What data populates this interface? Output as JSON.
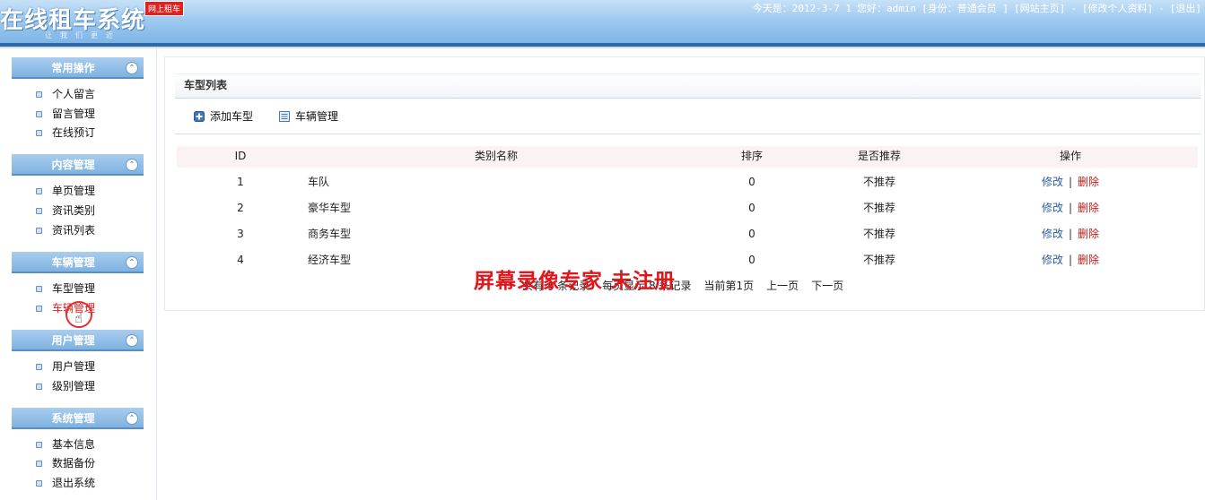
{
  "header": {
    "logo_title": "在线租车系统",
    "logo_badge": "网上租车",
    "logo_slogan": "让我们更近",
    "date_text": "今天是：2012-3-7 1",
    "greeting": "您好：admin",
    "identity": "[身份：普通会员 ]",
    "site_home": "[网站主页]",
    "dash1": "-",
    "edit_profile": "[修改个人资料]",
    "dash2": "-",
    "logout": "[退出]"
  },
  "sidebar": {
    "groups": [
      {
        "title": "常用操作",
        "items": [
          "个人留言",
          "留言管理",
          "在线预订"
        ]
      },
      {
        "title": "内容管理",
        "items": [
          "单页管理",
          "资讯类别",
          "资讯列表"
        ]
      },
      {
        "title": "车辆管理",
        "items": [
          "车型管理",
          "车辆管理"
        ]
      },
      {
        "title": "用户管理",
        "items": [
          "用户管理",
          "级别管理"
        ]
      },
      {
        "title": "系统管理",
        "items": [
          "基本信息",
          "数据备份",
          "退出系统"
        ]
      }
    ],
    "active_item": "车辆管理",
    "collapse_glyph": "⌃"
  },
  "main": {
    "panel_title": "车型列表",
    "toolbar": {
      "add_label": "添加车型",
      "manage_label": "车辆管理"
    },
    "table": {
      "columns": [
        "ID",
        "类别名称",
        "排序",
        "是否推荐",
        "操作"
      ],
      "rows": [
        {
          "id": "1",
          "name": "车队",
          "order": "0",
          "recommend": "不推荐",
          "edit": "修改",
          "sep": "|",
          "del": "删除"
        },
        {
          "id": "2",
          "name": "豪华车型",
          "order": "0",
          "recommend": "不推荐",
          "edit": "修改",
          "sep": "|",
          "del": "删除"
        },
        {
          "id": "3",
          "name": "商务车型",
          "order": "0",
          "recommend": "不推荐",
          "edit": "修改",
          "sep": "|",
          "del": "删除"
        },
        {
          "id": "4",
          "name": "经济车型",
          "order": "0",
          "recommend": "不推荐",
          "edit": "修改",
          "sep": "|",
          "del": "删除"
        }
      ]
    },
    "pager": {
      "total": "共有 4 条记录",
      "per_page": "每页显示 8 条记录",
      "current": "当前第1页",
      "prev": "上一页",
      "next": "下一页"
    }
  },
  "watermark": "屏幕录像专家 未注册",
  "colors": {
    "header_top": "#c7e1f7",
    "header_bottom": "#7fb5e6",
    "header_bar": "#2f68a8",
    "link_blue": "#2d5e9c",
    "delete_red": "#b02020",
    "watermark_red": "#e0161a"
  }
}
